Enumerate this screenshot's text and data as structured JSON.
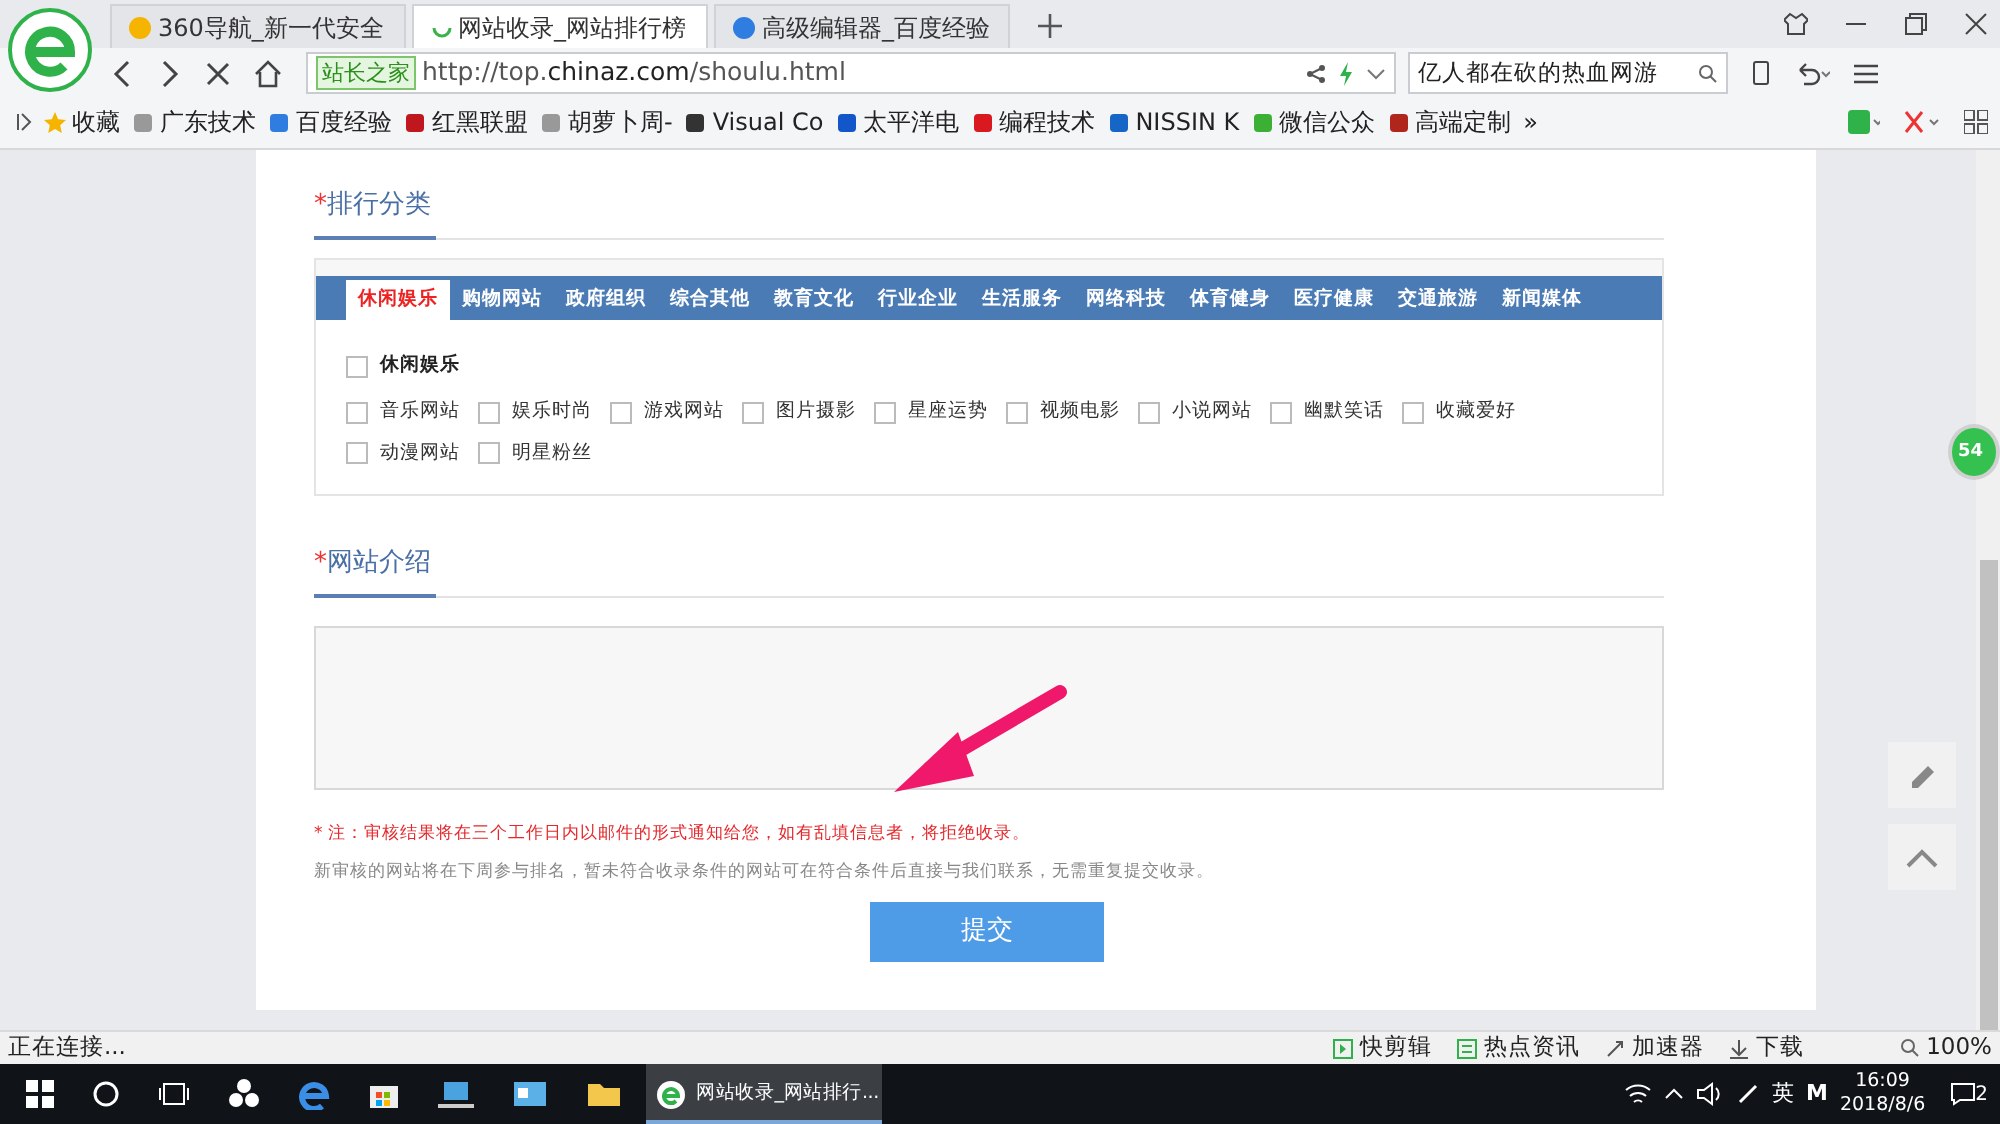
{
  "browser": {
    "tabs": [
      {
        "title": "360导航_新一代安全",
        "selected": false
      },
      {
        "title": "网站收录_网站排行榜",
        "selected": true
      },
      {
        "title": "高级编辑器_百度经验",
        "selected": false
      }
    ],
    "address": {
      "site_badge": "站长之家",
      "url": "http://top.**chinaz.com**/shoulu.html"
    },
    "search": {
      "value": "亿人都在砍的热血网游"
    },
    "bookmarks": [
      "收藏",
      "广东技术",
      "百度经验",
      "红黑联盟",
      "胡萝卜周-",
      "Visual Co",
      "太平洋电",
      "编程技术",
      "NISSIN K",
      "微信公众",
      "高端定制",
      "»"
    ]
  },
  "form": {
    "category_section": {
      "required_mark": "*",
      "title": "排行分类"
    },
    "category_tabs": [
      {
        "label": "休闲娱乐",
        "selected": true
      },
      {
        "label": "购物网站",
        "selected": false
      },
      {
        "label": "政府组织",
        "selected": false
      },
      {
        "label": "综合其他",
        "selected": false
      },
      {
        "label": "教育文化",
        "selected": false
      },
      {
        "label": "行业企业",
        "selected": false
      },
      {
        "label": "生活服务",
        "selected": false
      },
      {
        "label": "网络科技",
        "selected": false
      },
      {
        "label": "体育健身",
        "selected": false
      },
      {
        "label": "医疗健康",
        "selected": false
      },
      {
        "label": "交通旅游",
        "selected": false
      },
      {
        "label": "新闻媒体",
        "selected": false
      }
    ],
    "group_checkbox": {
      "label": "休闲娱乐",
      "checked": false
    },
    "options": [
      {
        "label": "音乐网站",
        "checked": false
      },
      {
        "label": "娱乐时尚",
        "checked": false
      },
      {
        "label": "游戏网站",
        "checked": false
      },
      {
        "label": "图片摄影",
        "checked": false
      },
      {
        "label": "星座运势",
        "checked": false
      },
      {
        "label": "视频电影",
        "checked": false
      },
      {
        "label": "小说网站",
        "checked": false
      },
      {
        "label": "幽默笑话",
        "checked": false
      },
      {
        "label": "收藏爱好",
        "checked": false
      },
      {
        "label": "动漫网站",
        "checked": false
      },
      {
        "label": "明星粉丝",
        "checked": false
      }
    ],
    "intro_section": {
      "required_mark": "*",
      "title": "网站介绍"
    },
    "notice": "* 注：审核结果将在三个工作日内以邮件的形式通知给您，如有乱填信息者，将拒绝收录。",
    "info": "新审核的网站将在下周参与排名，暂未符合收录条件的网站可在符合条件后直接与我们联系，无需重复提交收录。",
    "submit": "提交"
  },
  "side_badge": "54",
  "status_bar": {
    "text": "正在连接...",
    "items": [
      "快剪辑",
      "热点资讯",
      "加速器",
      "下载"
    ],
    "zoom": "100%"
  },
  "taskbar": {
    "window": "网站收录_网站排行...",
    "lang": "英",
    "ime": "M",
    "time": "16:09",
    "date": "2018/8/6",
    "notifications": "2"
  }
}
